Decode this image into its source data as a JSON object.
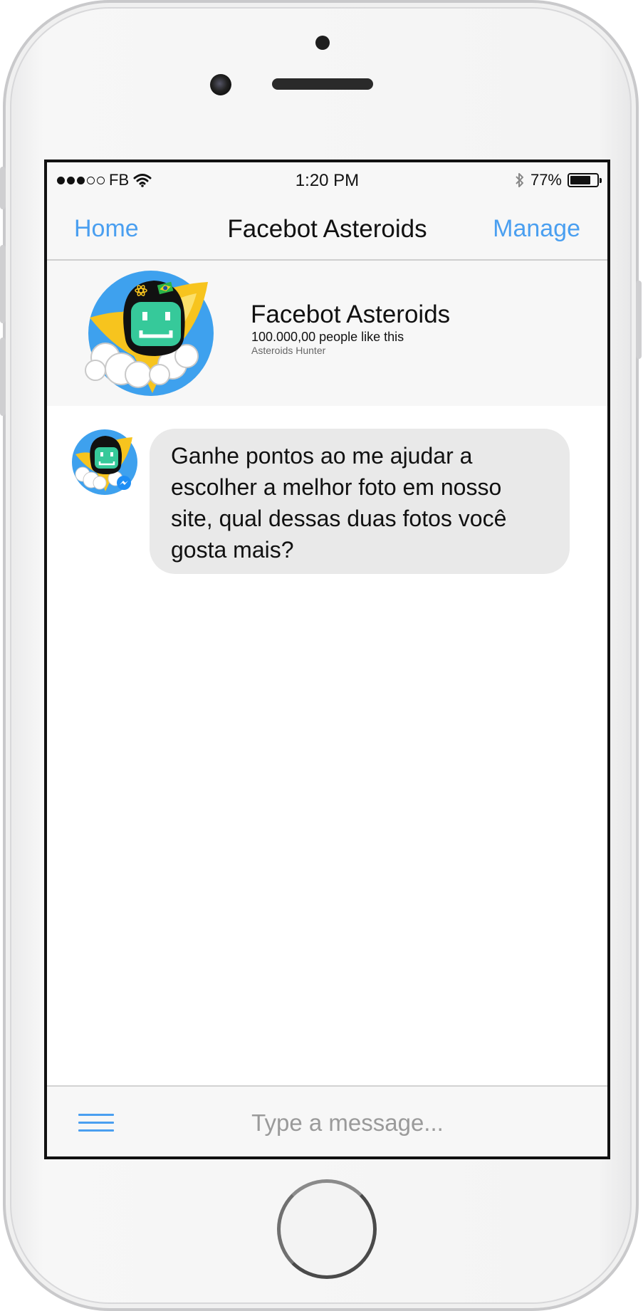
{
  "status_bar": {
    "carrier": "FB",
    "time": "1:20 PM",
    "battery_percent": "77%",
    "battery_level": 0.77,
    "signal_bars_filled": 3,
    "signal_bars_total": 5
  },
  "nav": {
    "left": "Home",
    "title": "Facebot Asteroids",
    "right": "Manage"
  },
  "page": {
    "name": "Facebot Asteroids",
    "likes": "100.000,00 people like this",
    "category": "Asteroids Hunter"
  },
  "messages": [
    {
      "from": "bot",
      "text": "Ganhe pontos ao me ajudar a escolher a melhor foto em nosso site, qual dessas duas fotos você gosta mais?"
    }
  ],
  "composer": {
    "placeholder": "Type a message..."
  },
  "colors": {
    "accent": "#4a9ff0",
    "bubble": "#e9e9e9",
    "avatar_blue": "#3ea1ee",
    "robot_green": "#36c99a",
    "rocket_yellow": "#f7c41e"
  },
  "icons": [
    "wifi-icon",
    "bluetooth-icon",
    "battery-icon",
    "menu-icon",
    "messenger-badge-icon"
  ]
}
